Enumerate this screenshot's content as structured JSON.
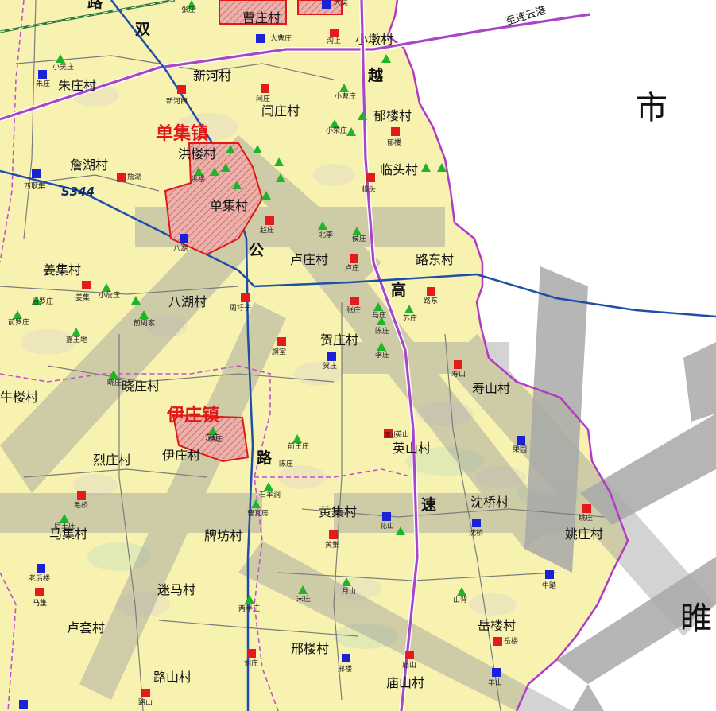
{
  "map": {
    "city_chars": [
      "市",
      "睢"
    ],
    "route_label": "S344",
    "road_label": "至连云港",
    "colors": {
      "land": "#f7f2b0",
      "boundary": "#b23ac4",
      "highway": "#1f4ea8",
      "expressway": "#a846c8",
      "town_fill": "#e6a7a7",
      "corridor": "#a6a6a6",
      "red_marker": "#e51b1b",
      "blue_marker": "#1b22d6",
      "green_marker": "#1fb52a"
    },
    "towns": [
      "单集镇",
      "伊庄镇"
    ],
    "road_chars": [
      "路",
      "双",
      "越",
      "公",
      "高",
      "路",
      "速"
    ],
    "villages": [
      "曹庄村",
      "小墩村",
      "朱庄村",
      "新河村",
      "闫庄村",
      "郁楼村",
      "詹湖村",
      "洪楼村",
      "临头村",
      "单集村",
      "卢庄村",
      "路东村",
      "姜集村",
      "八湖村",
      "贺庄村",
      "寿山村",
      "牛楼村",
      "晓庄村",
      "英山村",
      "烈庄村",
      "伊庄村",
      "沈桥村",
      "黄集村",
      "马集村",
      "牌坊村",
      "姚庄村",
      "迷马村",
      "岳楼村",
      "卢套村",
      "邢楼村",
      "路山村",
      "庙山村"
    ],
    "small_labels": [
      "张庄",
      "大吴",
      "大曹庄",
      "沟上",
      "小吴庄",
      "朱庄",
      "新河西",
      "闫庄",
      "小曹庄",
      "郁楼",
      "小荣庄",
      "西耿集",
      "詹湖",
      "洪楼",
      "临头",
      "赵庄",
      "北李",
      "侯庄",
      "卢庄",
      "八湖",
      "姜集",
      "小詹庄",
      "后罗庄",
      "前罗庄",
      "周圩子",
      "张庄",
      "马庄",
      "路东",
      "陈庄",
      "苏庄",
      "嘉王地",
      "前周家",
      "旗堂",
      "李庄",
      "贺庄",
      "寿山",
      "英山",
      "晓庄",
      "东庄",
      "英山",
      "前王庄",
      "伊庄",
      "毛桥",
      "后王庄",
      "陈庄",
      "石羊涧",
      "马庄",
      "果园",
      "曹瓦房",
      "花山",
      "黄集",
      "沈桥",
      "姚庄",
      "老后楼",
      "马集",
      "月山",
      "宋庄",
      "两半庄",
      "牛踏",
      "山背",
      "岳楼",
      "刘庄",
      "邢楼",
      "庙山",
      "羊山",
      "路山"
    ]
  }
}
